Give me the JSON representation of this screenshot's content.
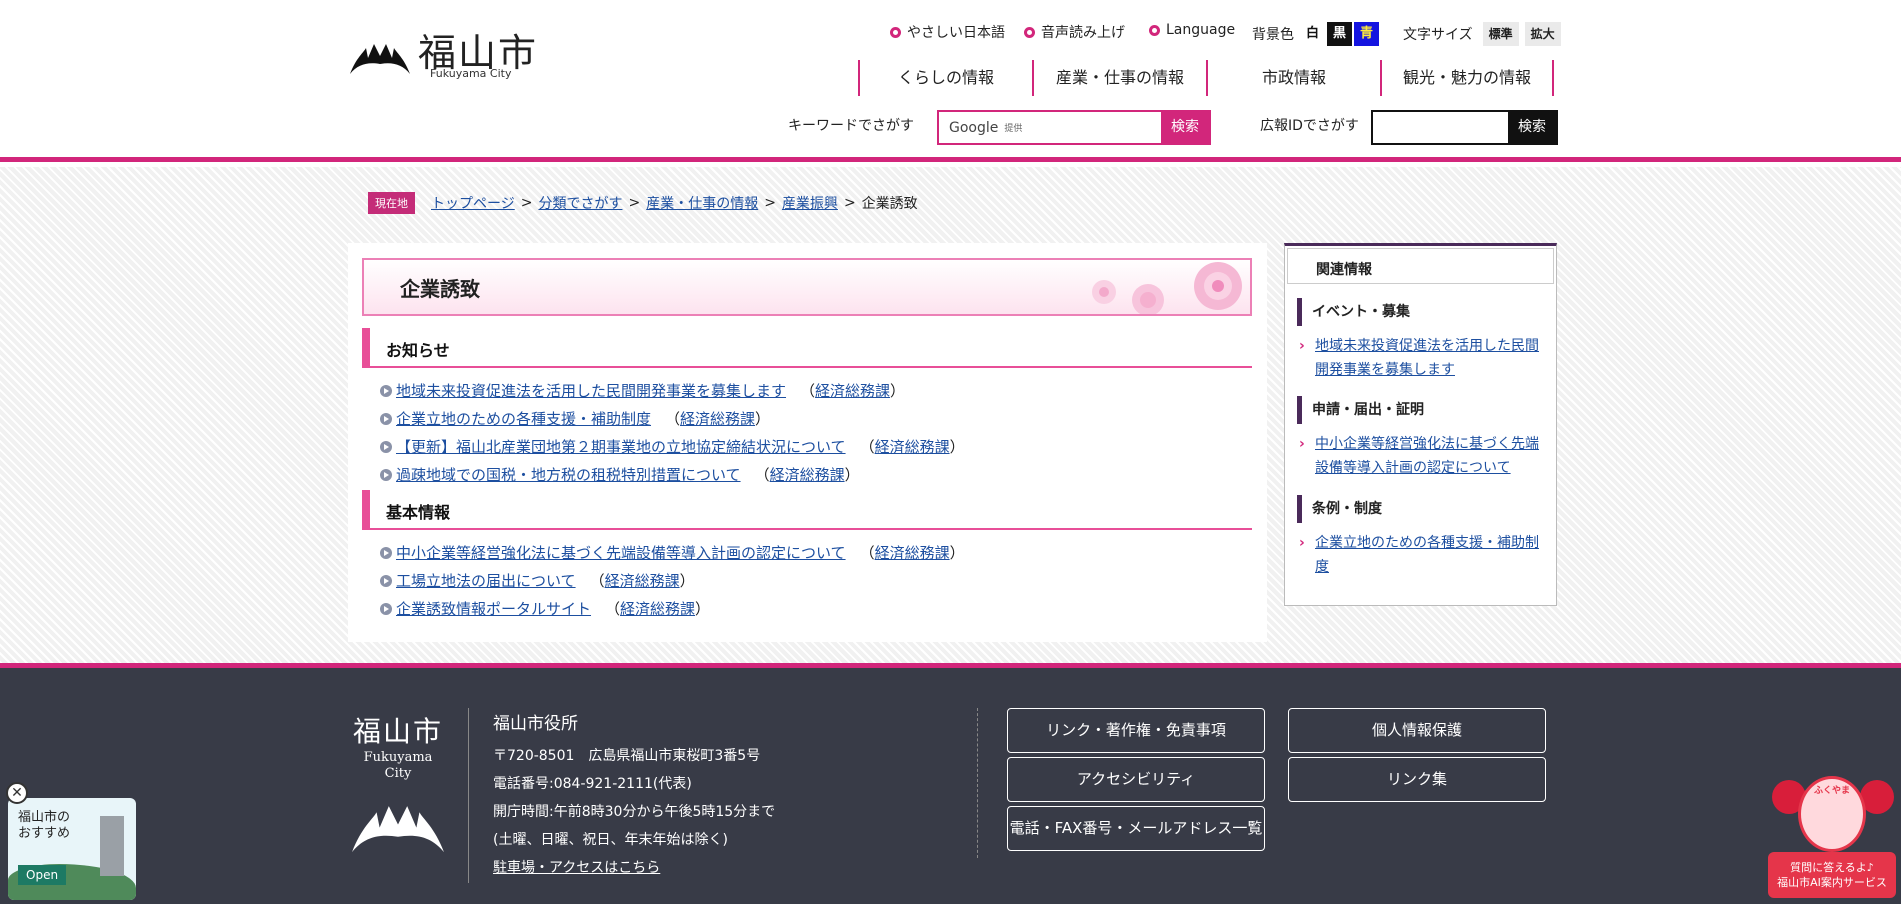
{
  "header": {
    "logo_jp": "福山市",
    "logo_en": "Fukuyama City",
    "util": {
      "easy_japanese": "やさしい日本語",
      "voice": "音声読み上げ",
      "language": "Language",
      "bg_label": "背景色",
      "bg_white": "白",
      "bg_black": "黒",
      "bg_blue": "青",
      "size_label": "文字サイズ",
      "size_normal": "標準",
      "size_large": "拡大"
    },
    "nav": [
      "くらしの情報",
      "産業・仕事の情報",
      "市政情報",
      "観光・魅力の情報"
    ],
    "keyword_label": "キーワードでさがす",
    "google_label": "Google",
    "google_provided": "提供",
    "search_button": "検索",
    "id_label": "広報IDでさがす",
    "id_search_button": "検索"
  },
  "breadcrumb": {
    "tag": "現在地",
    "items": [
      "トップページ",
      "分類でさがす",
      "産業・仕事の情報",
      "産業振興"
    ],
    "current": "企業誘致",
    "sep": ">"
  },
  "main": {
    "title": "企業誘致",
    "sections": [
      {
        "heading": "お知らせ",
        "links": [
          {
            "text": "地域未来投資促進法を活用した民間開発事業を募集します",
            "dept": "経済総務課"
          },
          {
            "text": "企業立地のための各種支援・補助制度",
            "dept": "経済総務課"
          },
          {
            "text": "【更新】福山北産業団地第２期事業地の立地協定締結状況について",
            "dept": "経済総務課"
          },
          {
            "text": "過疎地域での国税・地方税の租税特別措置について",
            "dept": "経済総務課"
          }
        ]
      },
      {
        "heading": "基本情報",
        "links": [
          {
            "text": "中小企業等経営強化法に基づく先端設備等導入計画の認定について",
            "dept": "経済総務課"
          },
          {
            "text": "工場立地法の届出について",
            "dept": "経済総務課"
          },
          {
            "text": "企業誘致情報ポータルサイト",
            "dept": "経済総務課"
          }
        ]
      }
    ]
  },
  "sidebar": {
    "heading": "関連情報",
    "groups": [
      {
        "title": "イベント・募集",
        "link": "地域未来投資促進法を活用した民間開発事業を募集します"
      },
      {
        "title": "申請・届出・証明",
        "link": "中小企業等経営強化法に基づく先端設備等導入計画の認定について"
      },
      {
        "title": "条例・制度",
        "link": "企業立地のための各種支援・補助制度"
      }
    ]
  },
  "footer": {
    "logo_jp": "福山市",
    "logo_en1": "Fukuyama",
    "logo_en2": "City",
    "office": "福山市役所",
    "address": "〒720-8501　広島県福山市東桜町3番5号",
    "phone": "電話番号:084-921-2111(代表)",
    "hours": "開庁時間:午前8時30分から午後5時15分まで",
    "hours_note": "(土曜、日曜、祝日、年末年始は除く)",
    "access": "駐車場・アクセスはこちら",
    "buttons": [
      "リンク・著作権・免責事項",
      "個人情報保護",
      "アクセシビリティ",
      "リンク集",
      "電話・FAX番号・メールアドレス一覧"
    ]
  },
  "floating": {
    "recommend": "福山市の\nおすすめ",
    "open": "Open",
    "ai_badge": "ふくやま",
    "ai_line1": "質問に答えるよ♪",
    "ai_line2": "福山市AI案内サービス"
  }
}
